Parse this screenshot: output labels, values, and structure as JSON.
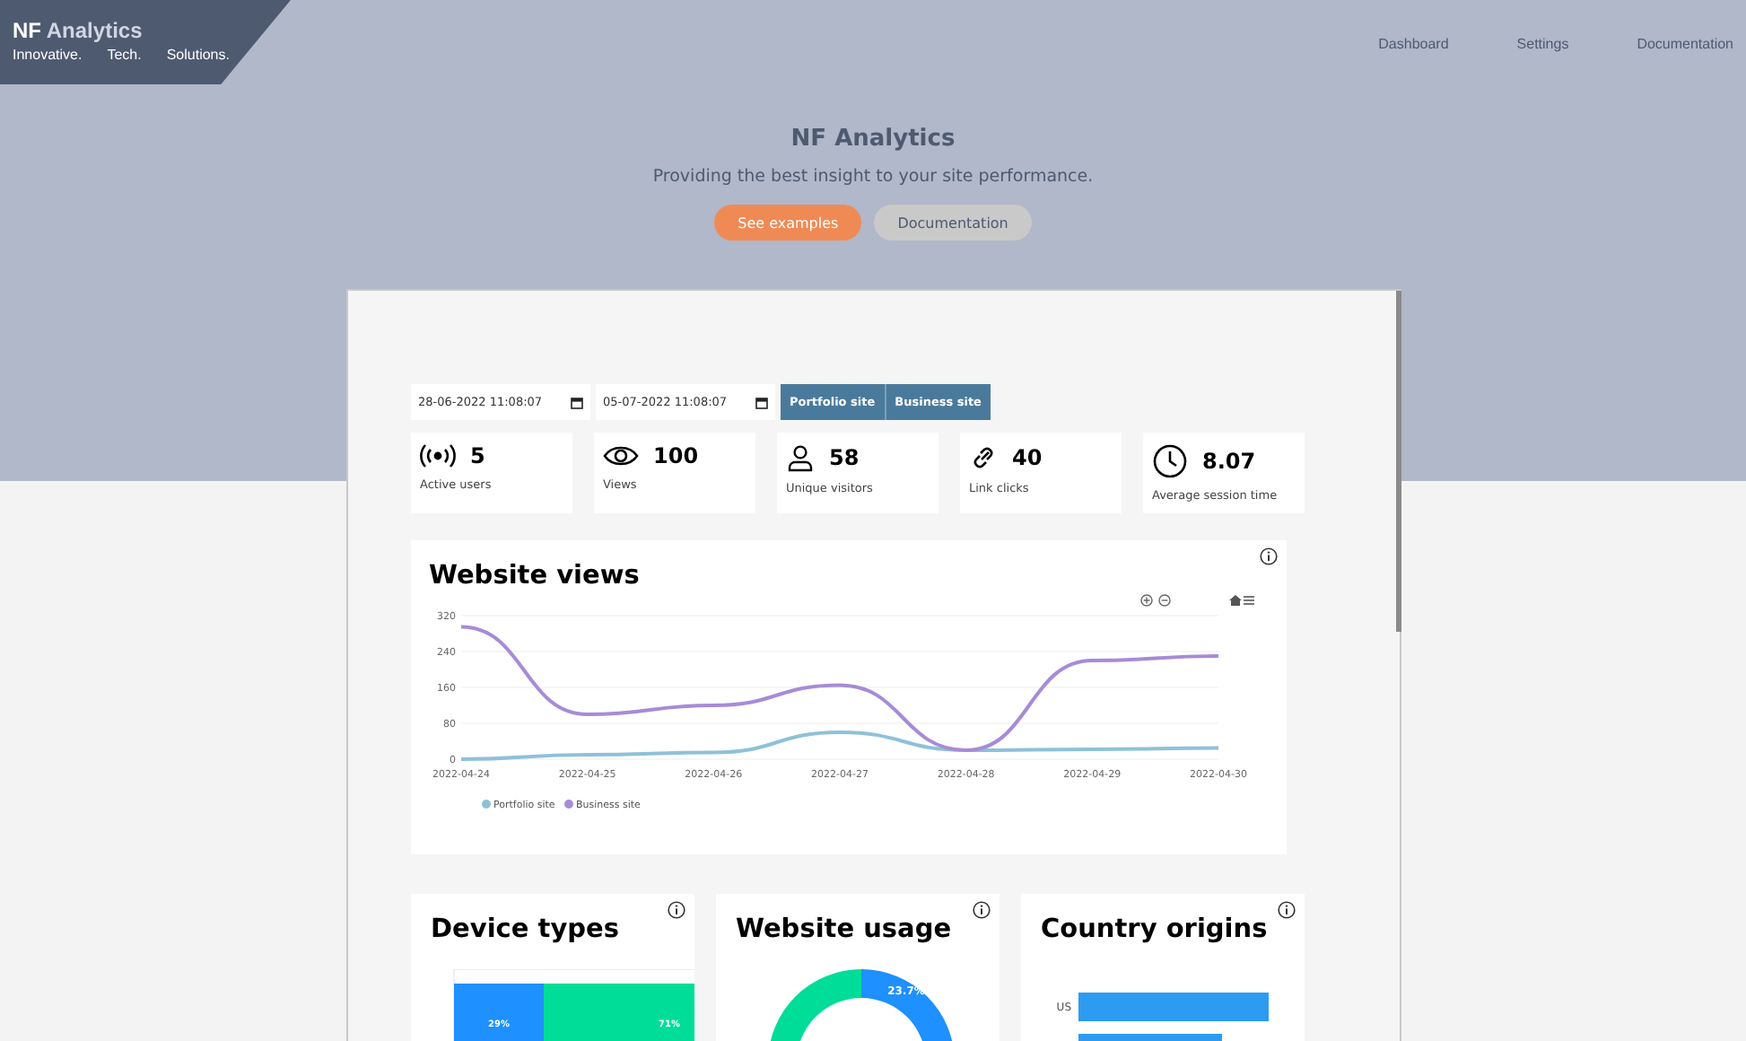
{
  "brand": {
    "name_bold": "NF",
    "name_rest": "Analytics",
    "taglines": [
      "Innovative.",
      "Tech.",
      "Solutions."
    ]
  },
  "nav": [
    {
      "label": "Dashboard"
    },
    {
      "label": "Settings"
    },
    {
      "label": "Documentation"
    }
  ],
  "hero": {
    "title": "NF Analytics",
    "subtitle": "Providing the best insight to your site performance.",
    "buttons": [
      {
        "label": "See examples",
        "kind": "primary"
      },
      {
        "label": "Documentation",
        "kind": "secondary"
      }
    ]
  },
  "filters": {
    "dates": [
      {
        "value": "28-06-2022 11:08:07"
      },
      {
        "value": "05-07-2022 11:08:07"
      }
    ],
    "sites": [
      {
        "label": "Portfolio site",
        "selected": false
      },
      {
        "label": "Business site",
        "selected": false
      }
    ]
  },
  "stats": [
    {
      "value": "5",
      "label": "Active users"
    },
    {
      "value": "100",
      "label": "Views"
    },
    {
      "value": "58",
      "label": "Unique visitors"
    },
    {
      "value": "40",
      "label": "Link clicks"
    },
    {
      "value": "8.07",
      "label": "Average session time"
    }
  ],
  "views_chart": {
    "title": "Website views",
    "chart_data": {
      "type": "line",
      "categories": [
        "2022-04-24",
        "2022-04-25",
        "2022-04-26",
        "2022-04-27",
        "2022-04-28",
        "2022-04-29",
        "2022-04-30"
      ],
      "ylim": [
        0,
        320
      ],
      "grid": true,
      "legend": true,
      "yticks": [
        0,
        80,
        160,
        240,
        320
      ],
      "series": [
        {
          "name": "Portfolio site",
          "color": "#8ec1d9",
          "values": [
            0,
            10,
            15,
            60,
            20,
            22,
            25
          ]
        },
        {
          "name": "Business site",
          "color": "#a78bd6",
          "values": [
            295,
            100,
            120,
            165,
            20,
            220,
            230
          ]
        }
      ]
    }
  },
  "bottom_cards": [
    {
      "title": "Device types",
      "kind": "bars",
      "labels": [
        "29%",
        "71%"
      ]
    },
    {
      "title": "Website usage",
      "kind": "donut",
      "labels": [
        "23.7%"
      ]
    },
    {
      "title": "Country origins",
      "kind": "hbars",
      "labels": [
        "US"
      ]
    }
  ]
}
